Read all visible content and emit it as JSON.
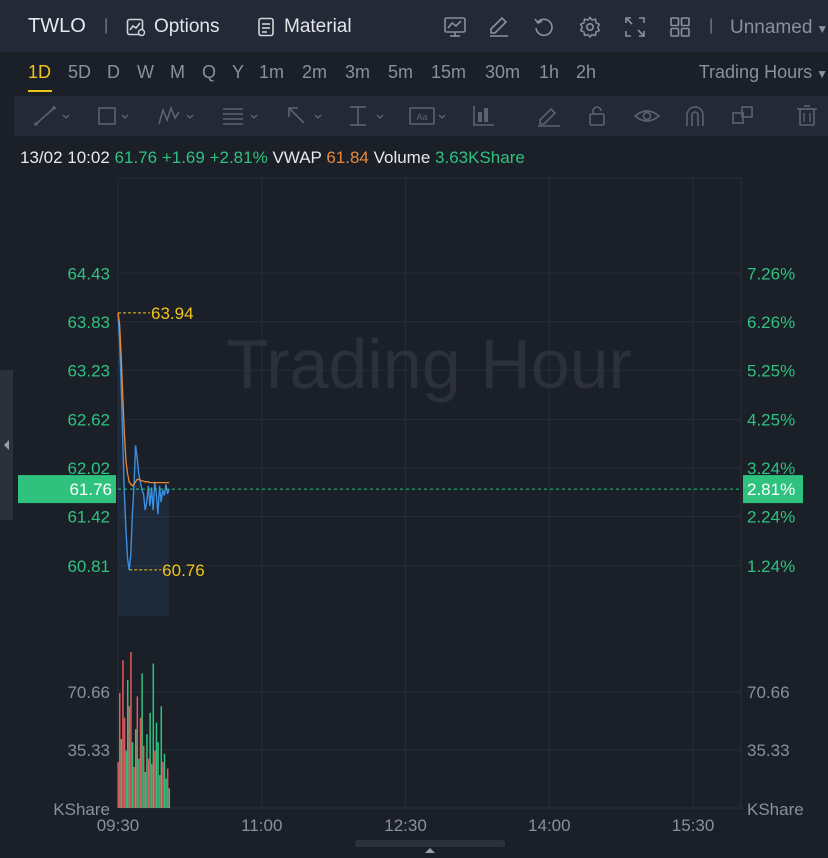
{
  "header": {
    "ticker": "TWLO",
    "options_label": "Options",
    "material_label": "Material",
    "layout_name": "Unnamed"
  },
  "timeframes": {
    "items": [
      "1D",
      "5D",
      "D",
      "W",
      "M",
      "Q",
      "Y",
      "1m",
      "2m",
      "3m",
      "5m",
      "15m",
      "30m",
      "1h",
      "2h"
    ],
    "active": "1D",
    "session_label": "Trading Hours"
  },
  "info": {
    "datetime": "13/02 10:02",
    "price": "61.76",
    "change": "+1.69",
    "change_pct": "+2.81%",
    "vwap_label": "VWAP",
    "vwap_value": "61.84",
    "volume_label": "Volume",
    "volume_value": "3.63KShare"
  },
  "watermark": "Trading Hour",
  "colors": {
    "up": "#2fc27f",
    "down": "#e05b5b",
    "price_line": "#3a8fe0",
    "vwap_line": "#e8893a",
    "marker": "#f0c419",
    "accent": "#f0c419"
  },
  "chart_data": {
    "type": "line",
    "x_ticks": [
      "09:30",
      "11:00",
      "12:30",
      "14:00",
      "15:30"
    ],
    "price_axis": {
      "ticks": [
        "64.43",
        "63.83",
        "63.23",
        "62.62",
        "62.02",
        "61.42",
        "60.81"
      ],
      "tick_values": [
        64.43,
        63.83,
        63.23,
        62.62,
        62.02,
        61.42,
        60.81
      ],
      "ylim": [
        60.19,
        64.99
      ]
    },
    "percent_axis": {
      "ticks": [
        "7.26%",
        "6.26%",
        "5.25%",
        "4.25%",
        "3.24%",
        "2.24%",
        "1.24%"
      ]
    },
    "current_price": "61.76",
    "current_pct": "2.81%",
    "high_label": "63.94",
    "high_value": 63.94,
    "low_label": "60.76",
    "low_value": 60.76,
    "series": [
      {
        "name": "Price",
        "x": [
          "09:30",
          "09:31",
          "09:32",
          "09:33",
          "09:34",
          "09:35",
          "09:36",
          "09:37",
          "09:38",
          "09:39",
          "09:40",
          "09:41",
          "09:42",
          "09:43",
          "09:44",
          "09:45",
          "09:46",
          "09:47",
          "09:48",
          "09:49",
          "09:50",
          "09:51",
          "09:52",
          "09:53",
          "09:54",
          "09:55",
          "09:56",
          "09:57",
          "09:58",
          "09:59",
          "10:00",
          "10:01",
          "10:02"
        ],
        "values": [
          63.94,
          63.6,
          63.05,
          62.35,
          61.7,
          61.25,
          60.9,
          60.76,
          60.95,
          61.45,
          61.8,
          62.3,
          62.15,
          61.95,
          61.85,
          61.75,
          61.7,
          61.5,
          61.6,
          61.8,
          61.55,
          61.78,
          61.5,
          61.85,
          61.7,
          61.45,
          61.8,
          61.6,
          61.75,
          61.68,
          61.82,
          61.7,
          61.76
        ]
      },
      {
        "name": "VWAP",
        "x": [
          "09:30",
          "09:31",
          "09:32",
          "09:33",
          "09:34",
          "09:35",
          "09:36",
          "09:37",
          "09:38",
          "09:39",
          "09:40",
          "09:41",
          "09:42",
          "09:43",
          "09:44",
          "09:45",
          "09:46",
          "09:47",
          "09:48",
          "09:49",
          "09:50",
          "09:51",
          "09:52",
          "09:53",
          "09:54",
          "09:55",
          "09:56",
          "09:57",
          "09:58",
          "09:59",
          "10:00",
          "10:01",
          "10:02"
        ],
        "values": [
          63.94,
          63.8,
          63.4,
          62.9,
          62.45,
          62.1,
          61.95,
          61.85,
          61.82,
          61.8,
          61.82,
          61.85,
          61.88,
          61.88,
          61.87,
          61.86,
          61.86,
          61.85,
          61.85,
          61.85,
          61.84,
          61.84,
          61.84,
          61.84,
          61.84,
          61.84,
          61.84,
          61.84,
          61.84,
          61.84,
          61.84,
          61.84,
          61.84
        ]
      }
    ],
    "volume_axis": {
      "ticks": [
        "70.66",
        "35.33"
      ],
      "tick_values": [
        70.66,
        35.33
      ],
      "unit": "KShare",
      "ylim": [
        0,
        106
      ]
    },
    "volume": {
      "x": [
        "09:30",
        "09:31",
        "09:32",
        "09:33",
        "09:34",
        "09:35",
        "09:36",
        "09:37",
        "09:38",
        "09:39",
        "09:40",
        "09:41",
        "09:42",
        "09:43",
        "09:44",
        "09:45",
        "09:46",
        "09:47",
        "09:48",
        "09:49",
        "09:50",
        "09:51",
        "09:52",
        "09:53",
        "09:54",
        "09:55",
        "09:56",
        "09:57",
        "09:58",
        "09:59",
        "10:00",
        "10:01",
        "10:02"
      ],
      "values": [
        28,
        70,
        42,
        90,
        55,
        35,
        78,
        62,
        95,
        40,
        25,
        48,
        68,
        30,
        55,
        82,
        38,
        22,
        45,
        30,
        58,
        27,
        88,
        35,
        52,
        40,
        20,
        62,
        28,
        33,
        18,
        24,
        12
      ],
      "direction": [
        "down",
        "down",
        "up",
        "down",
        "down",
        "up",
        "up",
        "down",
        "down",
        "up",
        "down",
        "up",
        "down",
        "up",
        "down",
        "up",
        "down",
        "up",
        "up",
        "down",
        "up",
        "down",
        "up",
        "down",
        "up",
        "up",
        "down",
        "up",
        "down",
        "up",
        "up",
        "down",
        "up"
      ]
    }
  }
}
